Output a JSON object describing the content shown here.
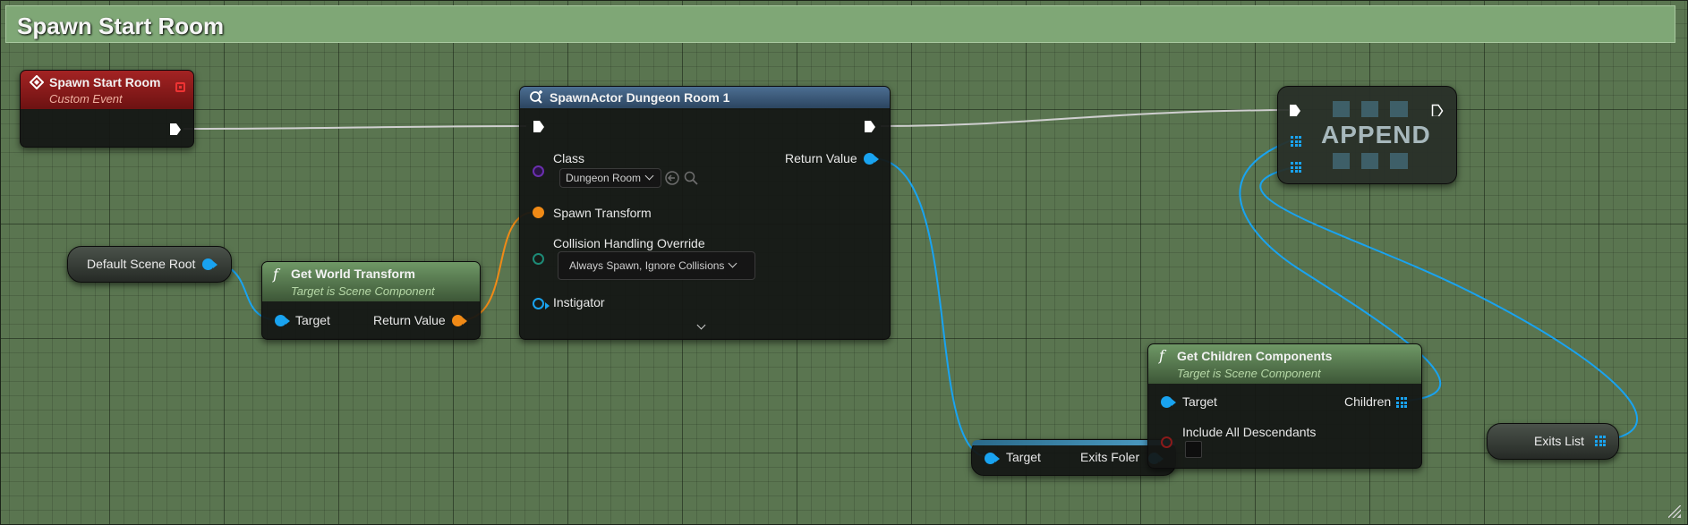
{
  "comment": {
    "title": "Spawn Start Room"
  },
  "colors": {
    "canvas": "#5a7550",
    "comment_bar": "#7fa776",
    "event_header": "#8a1c1c",
    "function_header": "#5c7a55",
    "spawn_header": "#3d5a78",
    "object_pin": "#19a3f0",
    "struct_pin": "#f08a16",
    "exec_wire": "#cfcfcf"
  },
  "event_node": {
    "title": "Spawn Start Room",
    "subtitle": "Custom Event",
    "icon": "diamond-event-icon"
  },
  "spawn_node": {
    "title": "SpawnActor Dungeon Room 1",
    "icon": "spawn-actor-icon",
    "class_label": "Class",
    "class_value": "Dungeon Room",
    "return_label": "Return Value",
    "spawn_transform_label": "Spawn Transform",
    "collision_label": "Collision Handling Override",
    "collision_value": "Always Spawn, Ignore Collisions",
    "instigator_label": "Instigator"
  },
  "default_scene_root": {
    "label": "Default Scene Root"
  },
  "get_world_transform": {
    "title": "Get World Transform",
    "subtitle": "Target is Scene Component",
    "target_label": "Target",
    "return_label": "Return Value"
  },
  "append_node": {
    "label": "APPEND"
  },
  "exits_foler_node": {
    "target_label": "Target",
    "output_label": "Exits Foler"
  },
  "get_children": {
    "title": "Get Children Components",
    "subtitle": "Target is Scene Component",
    "target_label": "Target",
    "children_label": "Children",
    "descendants_label": "Include All Descendants"
  },
  "exits_list": {
    "label": "Exits List"
  }
}
